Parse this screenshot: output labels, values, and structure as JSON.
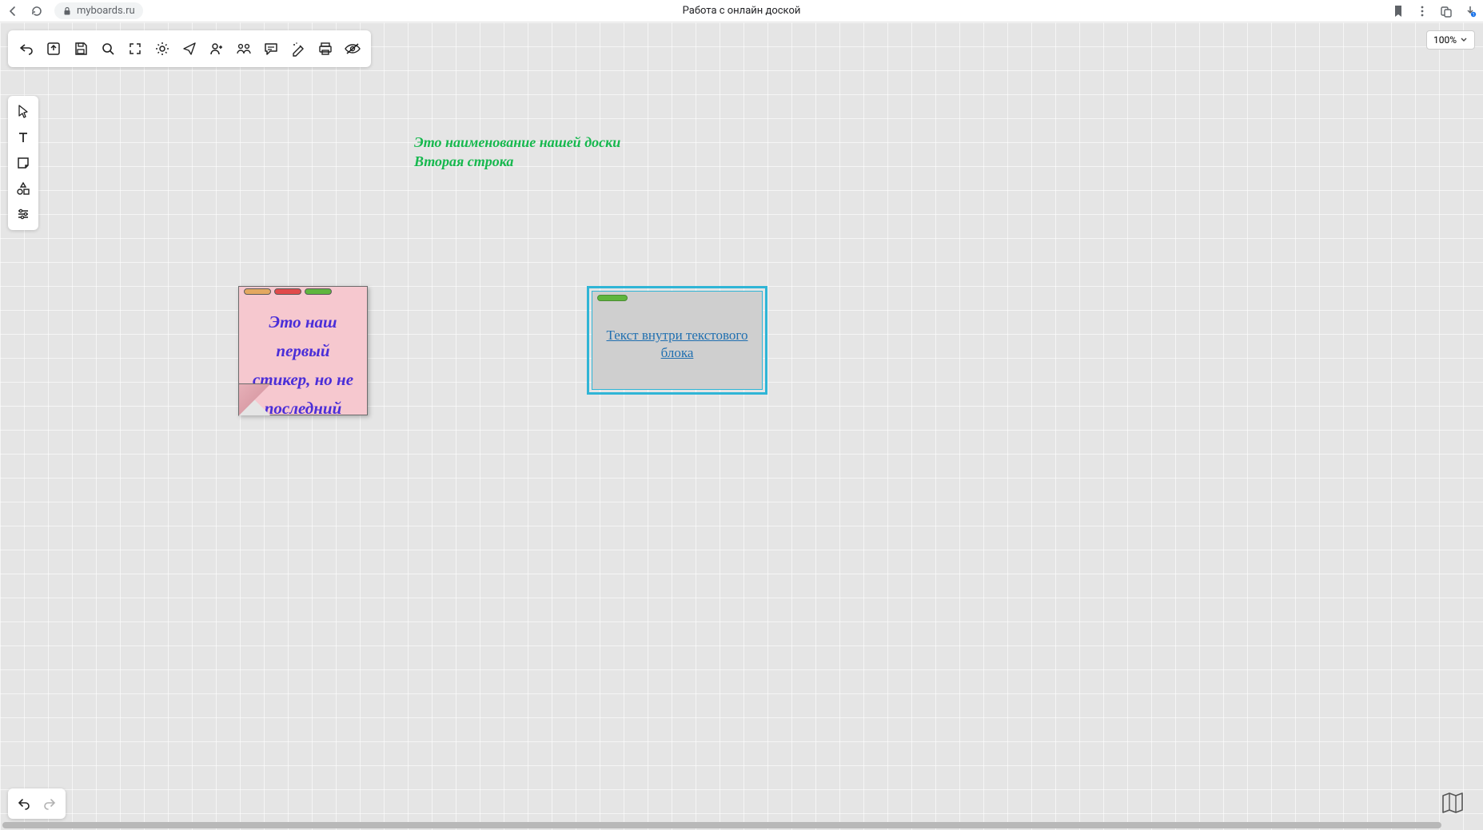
{
  "browser": {
    "url": "myboards.ru",
    "page_title": "Работа с онлайн доской"
  },
  "zoom": {
    "level": "100%"
  },
  "board_title": {
    "line1": "Это наименование нашей доски",
    "line2": "Вторая строка"
  },
  "sticker": {
    "text": "Это наш первый стикер, но не последний",
    "tag_colors": [
      "#e3a860",
      "#e04a4a",
      "#5fb63e"
    ]
  },
  "text_block": {
    "text": "Текст внутри текстового блока",
    "tag_color": "#5fb63e"
  },
  "top_toolbar": {
    "items": [
      "undo",
      "import",
      "save",
      "search",
      "fullscreen",
      "settings",
      "send",
      "invite",
      "present",
      "comment",
      "draw",
      "print",
      "hide"
    ]
  },
  "left_toolbar": {
    "items": [
      "pointer",
      "text",
      "note",
      "shapes",
      "sliders"
    ]
  }
}
